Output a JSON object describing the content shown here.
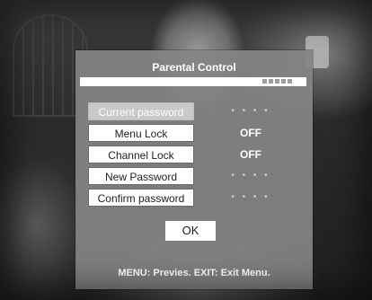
{
  "dialog": {
    "title": "Parental Control",
    "progress_indicator": "▪▪▪▪▪"
  },
  "rows": [
    {
      "label": "Current password",
      "value": "• • • •",
      "selected": true
    },
    {
      "label": "Menu Lock",
      "value": "OFF"
    },
    {
      "label": "Channel Lock",
      "value": "OFF"
    },
    {
      "label": "New Password",
      "value": "• • • •"
    },
    {
      "label": "Confirm password",
      "value": "• • • •"
    }
  ],
  "ok_label": "OK",
  "footer": "MENU:  Previes.   EXIT:  Exit Menu.",
  "colors": {
    "panel": "#848484",
    "button": "#ffffff",
    "selected_button": "#c9c9c9",
    "text": "#ffffff"
  }
}
